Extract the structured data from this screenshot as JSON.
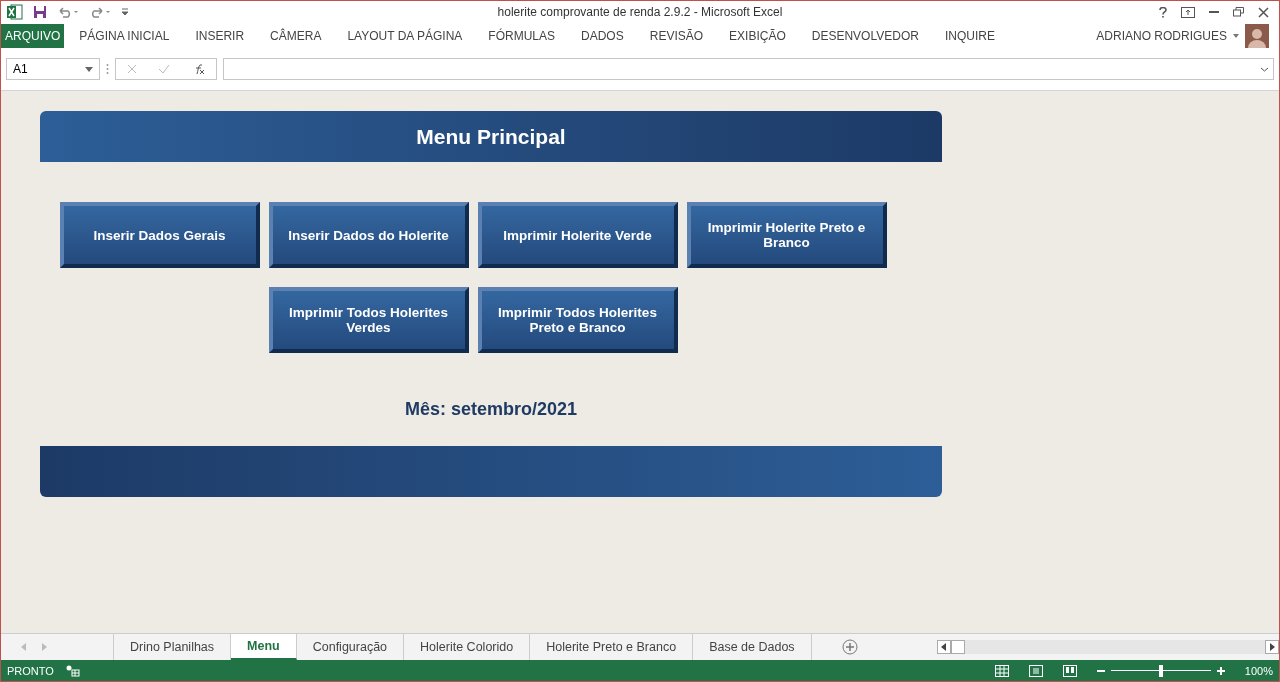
{
  "window": {
    "title": "holerite comprovante de renda 2.9.2 - Microsoft Excel"
  },
  "ribbon_tabs": [
    {
      "label": "ARQUIVO",
      "selected": true
    },
    {
      "label": "PÁGINA INICIAL",
      "selected": false
    },
    {
      "label": "INSERIR",
      "selected": false
    },
    {
      "label": "CÂMERA",
      "selected": false
    },
    {
      "label": "LAYOUT DA PÁGINA",
      "selected": false
    },
    {
      "label": "FÓRMULAS",
      "selected": false
    },
    {
      "label": "DADOS",
      "selected": false
    },
    {
      "label": "REVISÃO",
      "selected": false
    },
    {
      "label": "EXIBIÇÃO",
      "selected": false
    },
    {
      "label": "DESENVOLVEDOR",
      "selected": false
    },
    {
      "label": "INQUIRE",
      "selected": false
    }
  ],
  "user": {
    "name": "ADRIANO RODRIGUES"
  },
  "formula_bar": {
    "name_box": "A1"
  },
  "sheet": {
    "header": "Menu Principal",
    "button_rows": [
      [
        "Inserir Dados Gerais",
        "Inserir Dados do Holerite",
        "Imprimir Holerite Verde",
        "Imprimir Holerite Preto e Branco"
      ],
      [
        "Imprimir Todos Holerites Verdes",
        "Imprimir Todos Holerites Preto e Branco"
      ]
    ],
    "month": "Mês: setembro/2021"
  },
  "sheet_tabs": [
    {
      "label": "Drino Planilhas",
      "selected": false
    },
    {
      "label": "Menu",
      "selected": true
    },
    {
      "label": "Configuração",
      "selected": false
    },
    {
      "label": "Holerite Colorido",
      "selected": false
    },
    {
      "label": "Holerite Preto e Branco",
      "selected": false
    },
    {
      "label": "Base de Dados",
      "selected": false
    }
  ],
  "status_bar": {
    "status": "PRONTO",
    "zoom": "100%",
    "zoom_slider": {
      "level": 0.5
    }
  }
}
